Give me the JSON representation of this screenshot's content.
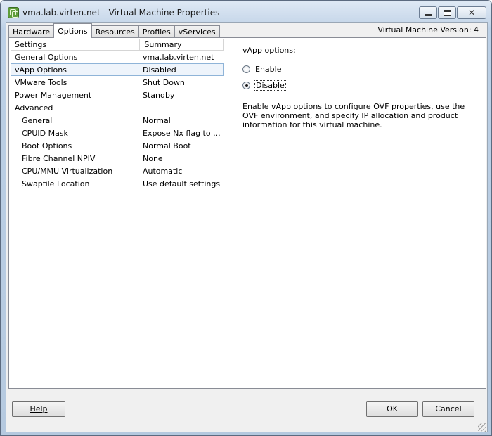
{
  "window": {
    "title": "vma.lab.virten.net - Virtual Machine Properties",
    "app_icon": "vm-icon",
    "controls": [
      "minimize",
      "maximize",
      "close"
    ]
  },
  "tabs": [
    {
      "label": "Hardware",
      "active": false
    },
    {
      "label": "Options",
      "active": true
    },
    {
      "label": "Resources",
      "active": false
    },
    {
      "label": "Profiles",
      "active": false
    },
    {
      "label": "vServices",
      "active": false
    }
  ],
  "vm_version": "Virtual Machine Version: 4",
  "settings_list": {
    "headers": [
      "Settings",
      "Summary"
    ],
    "rows": [
      {
        "setting": "General Options",
        "summary": "vma.lab.virten.net",
        "indent": false,
        "selected": false
      },
      {
        "setting": "vApp Options",
        "summary": "Disabled",
        "indent": false,
        "selected": true
      },
      {
        "setting": "VMware Tools",
        "summary": "Shut Down",
        "indent": false,
        "selected": false
      },
      {
        "setting": "Power Management",
        "summary": "Standby",
        "indent": false,
        "selected": false
      },
      {
        "setting": "Advanced",
        "summary": "",
        "indent": false,
        "selected": false
      },
      {
        "setting": "General",
        "summary": "Normal",
        "indent": true,
        "selected": false
      },
      {
        "setting": "CPUID Mask",
        "summary": "Expose Nx flag to ...",
        "indent": true,
        "selected": false
      },
      {
        "setting": "Boot Options",
        "summary": "Normal Boot",
        "indent": true,
        "selected": false
      },
      {
        "setting": "Fibre Channel NPIV",
        "summary": "None",
        "indent": true,
        "selected": false
      },
      {
        "setting": "CPU/MMU Virtualization",
        "summary": "Automatic",
        "indent": true,
        "selected": false
      },
      {
        "setting": "Swapfile Location",
        "summary": "Use default settings",
        "indent": true,
        "selected": false
      }
    ]
  },
  "vapp_panel": {
    "heading": "vApp options:",
    "options": [
      {
        "label": "Enable",
        "checked": false
      },
      {
        "label": "Disable",
        "checked": true
      }
    ],
    "description": "Enable vApp options to configure OVF properties, use the OVF environment, and specify IP allocation and product information for this virtual machine."
  },
  "buttons": {
    "help": "Help",
    "ok": "OK",
    "cancel": "Cancel"
  }
}
